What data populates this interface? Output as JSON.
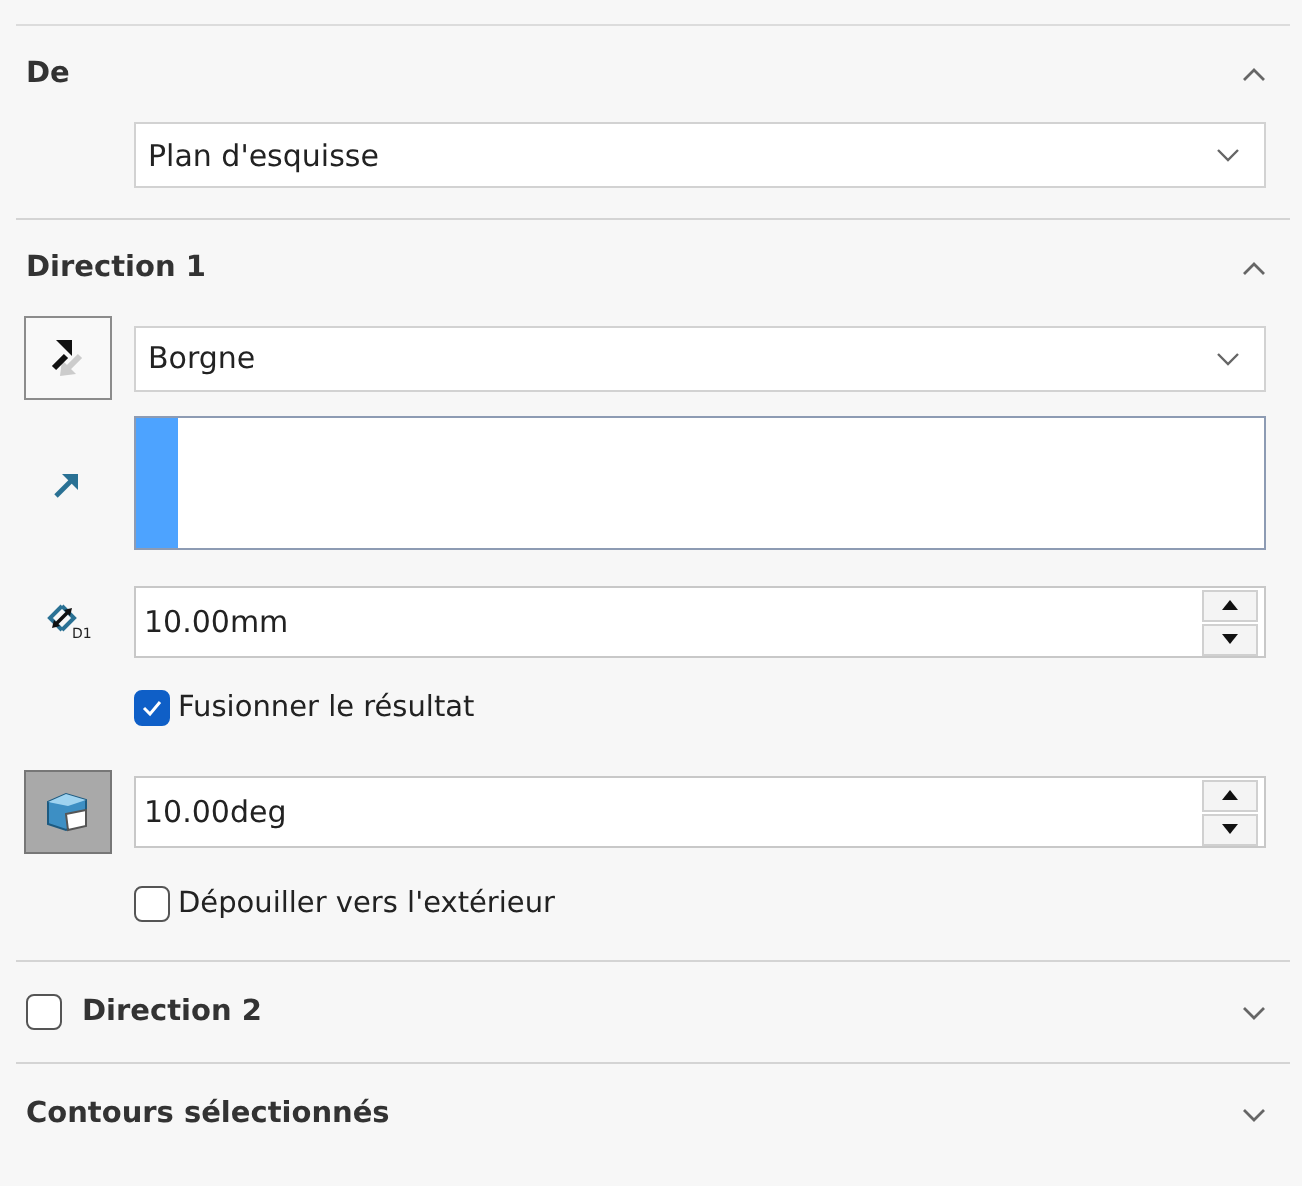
{
  "sections": [
    {
      "kind": "plain",
      "title": "De",
      "expanded": true,
      "rows": [
        {
          "kind": "dropdown",
          "value": "Plan d'esquisse"
        }
      ]
    },
    {
      "kind": "plain",
      "title": "Direction 1",
      "expanded": true,
      "rows": [
        {
          "kind": "dropdown",
          "pressed": false,
          "value": "Borgne"
        },
        {
          "kind": "selection"
        },
        {
          "kind": "spin",
          "icon_label": "D1",
          "value": "10.00mm"
        },
        {
          "kind": "check",
          "label": "Fusionner le résultat",
          "checked": true
        },
        {
          "kind": "spin",
          "pressed": true,
          "value": "10.00deg"
        },
        {
          "kind": "check",
          "label": "Dépouiller vers l'extérieur",
          "checked": false
        }
      ]
    },
    {
      "kind": "check",
      "title": "Direction 2",
      "checked": false,
      "expanded": false
    },
    {
      "kind": "plain",
      "title": "Contours sélectionnés",
      "expanded": false
    }
  ]
}
